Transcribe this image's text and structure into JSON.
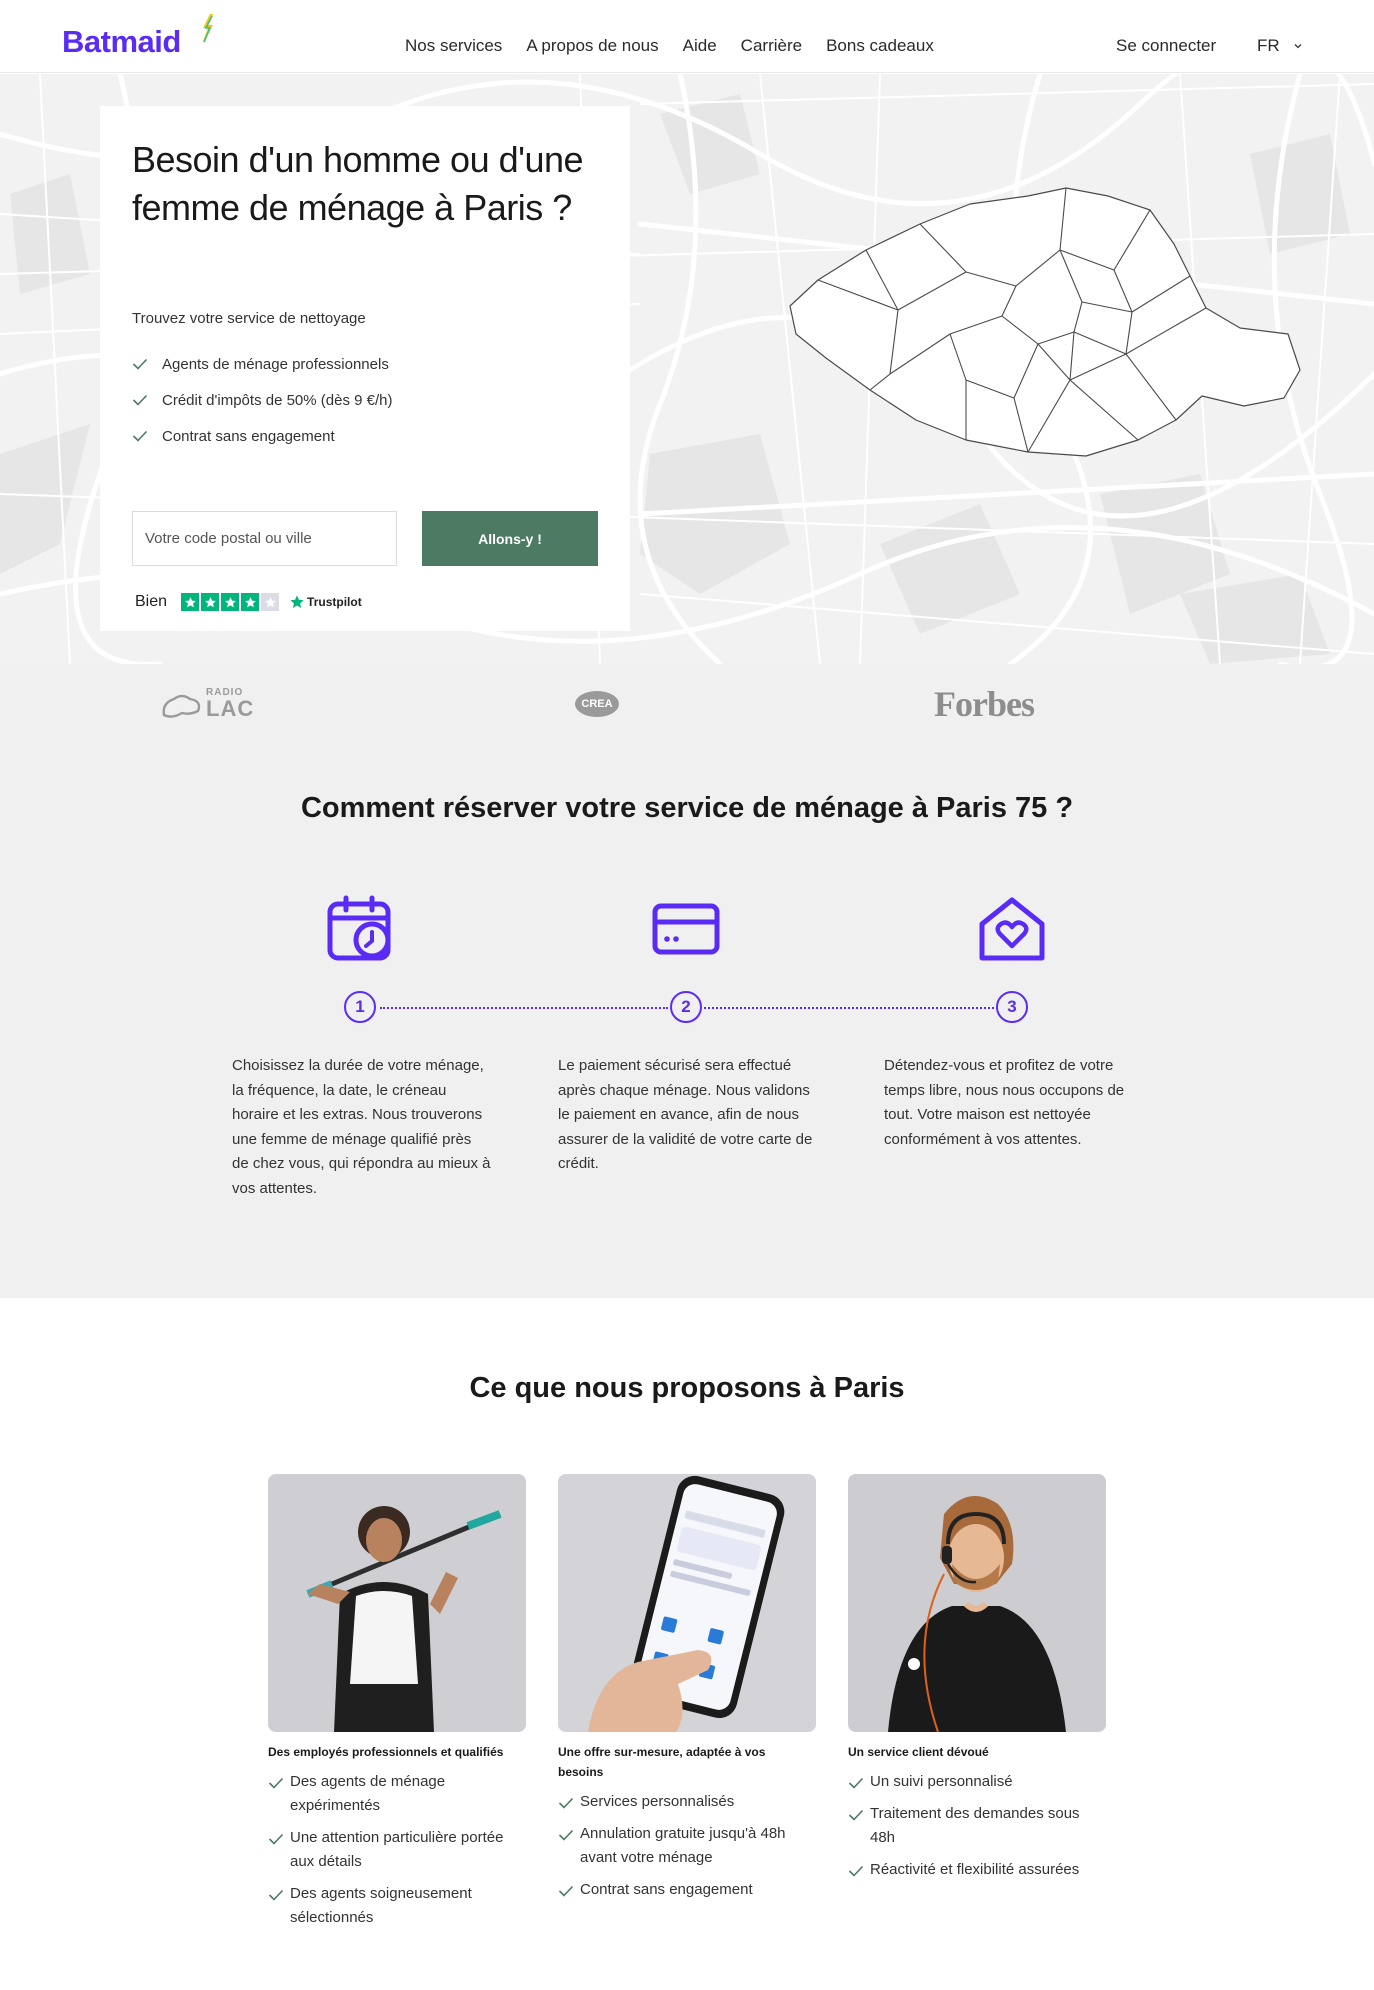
{
  "header": {
    "logo": "Batmaid",
    "nav": [
      "Nos services",
      "A propos de nous",
      "Aide",
      "Carrière",
      "Bons cadeaux"
    ],
    "login": "Se connecter",
    "language": "FR"
  },
  "hero": {
    "title": "Besoin d'un homme ou d'une femme de ménage à Paris ?",
    "subtitle": "Trouvez votre service de nettoyage",
    "checks": [
      "Agents de ménage professionnels",
      "Crédit d'impôts de 50% (dès 9 €/h)",
      "Contrat sans engagement"
    ],
    "postal_placeholder": "Votre code postal ou ville",
    "cta": "Allons-y !",
    "rating_label": "Bien",
    "stars_filled": 4,
    "stars_total": 5,
    "trustpilot": "Trustpilot"
  },
  "press": {
    "radio_small": "RADIO",
    "radio_big": "LAC",
    "crea": "CREA",
    "forbes": "Forbes"
  },
  "steps": {
    "title": "Comment réserver votre service de ménage à Paris 75 ?",
    "items": [
      {
        "num": "1",
        "icon": "calendar-clock-icon",
        "text": "Choisissez la durée de votre ménage, la fréquence, la date, le créneau horaire et les extras. Nous trouverons une femme de ménage qualifié près de chez vous, qui répondra au mieux à vos attentes."
      },
      {
        "num": "2",
        "icon": "credit-card-icon",
        "text": "Le paiement sécurisé sera effectué après chaque ménage. Nous validons le paiement en avance, afin de nous assurer de la validité de votre carte de crédit."
      },
      {
        "num": "3",
        "icon": "house-heart-icon",
        "text": "Détendez-vous et profitez de votre temps libre, nous nous occupons de tout. Votre maison est nettoyée conformément à vos attentes."
      }
    ]
  },
  "offer": {
    "title": "Ce que nous proposons à Paris",
    "cards": [
      {
        "title": "Des employés professionnels et qualifiés",
        "items": [
          "Des agents de ménage expérimentés",
          "Une attention particulière portée aux détails",
          "Des agents soigneusement sélectionnés"
        ]
      },
      {
        "title": "Une offre sur-mesure, adaptée à vos besoins",
        "items": [
          "Services personnalisés",
          "Annulation gratuite jusqu'à 48h avant votre ménage",
          "Contrat sans engagement"
        ]
      },
      {
        "title": "Un service client dévoué",
        "items": [
          "Un suivi personnalisé",
          "Traitement des demandes sous 48h",
          "Réactivité et flexibilité assurées"
        ]
      }
    ]
  },
  "colors": {
    "brand": "#5b2bf6",
    "cta": "#4c7a63",
    "trustpilot_green": "#00b67a"
  }
}
